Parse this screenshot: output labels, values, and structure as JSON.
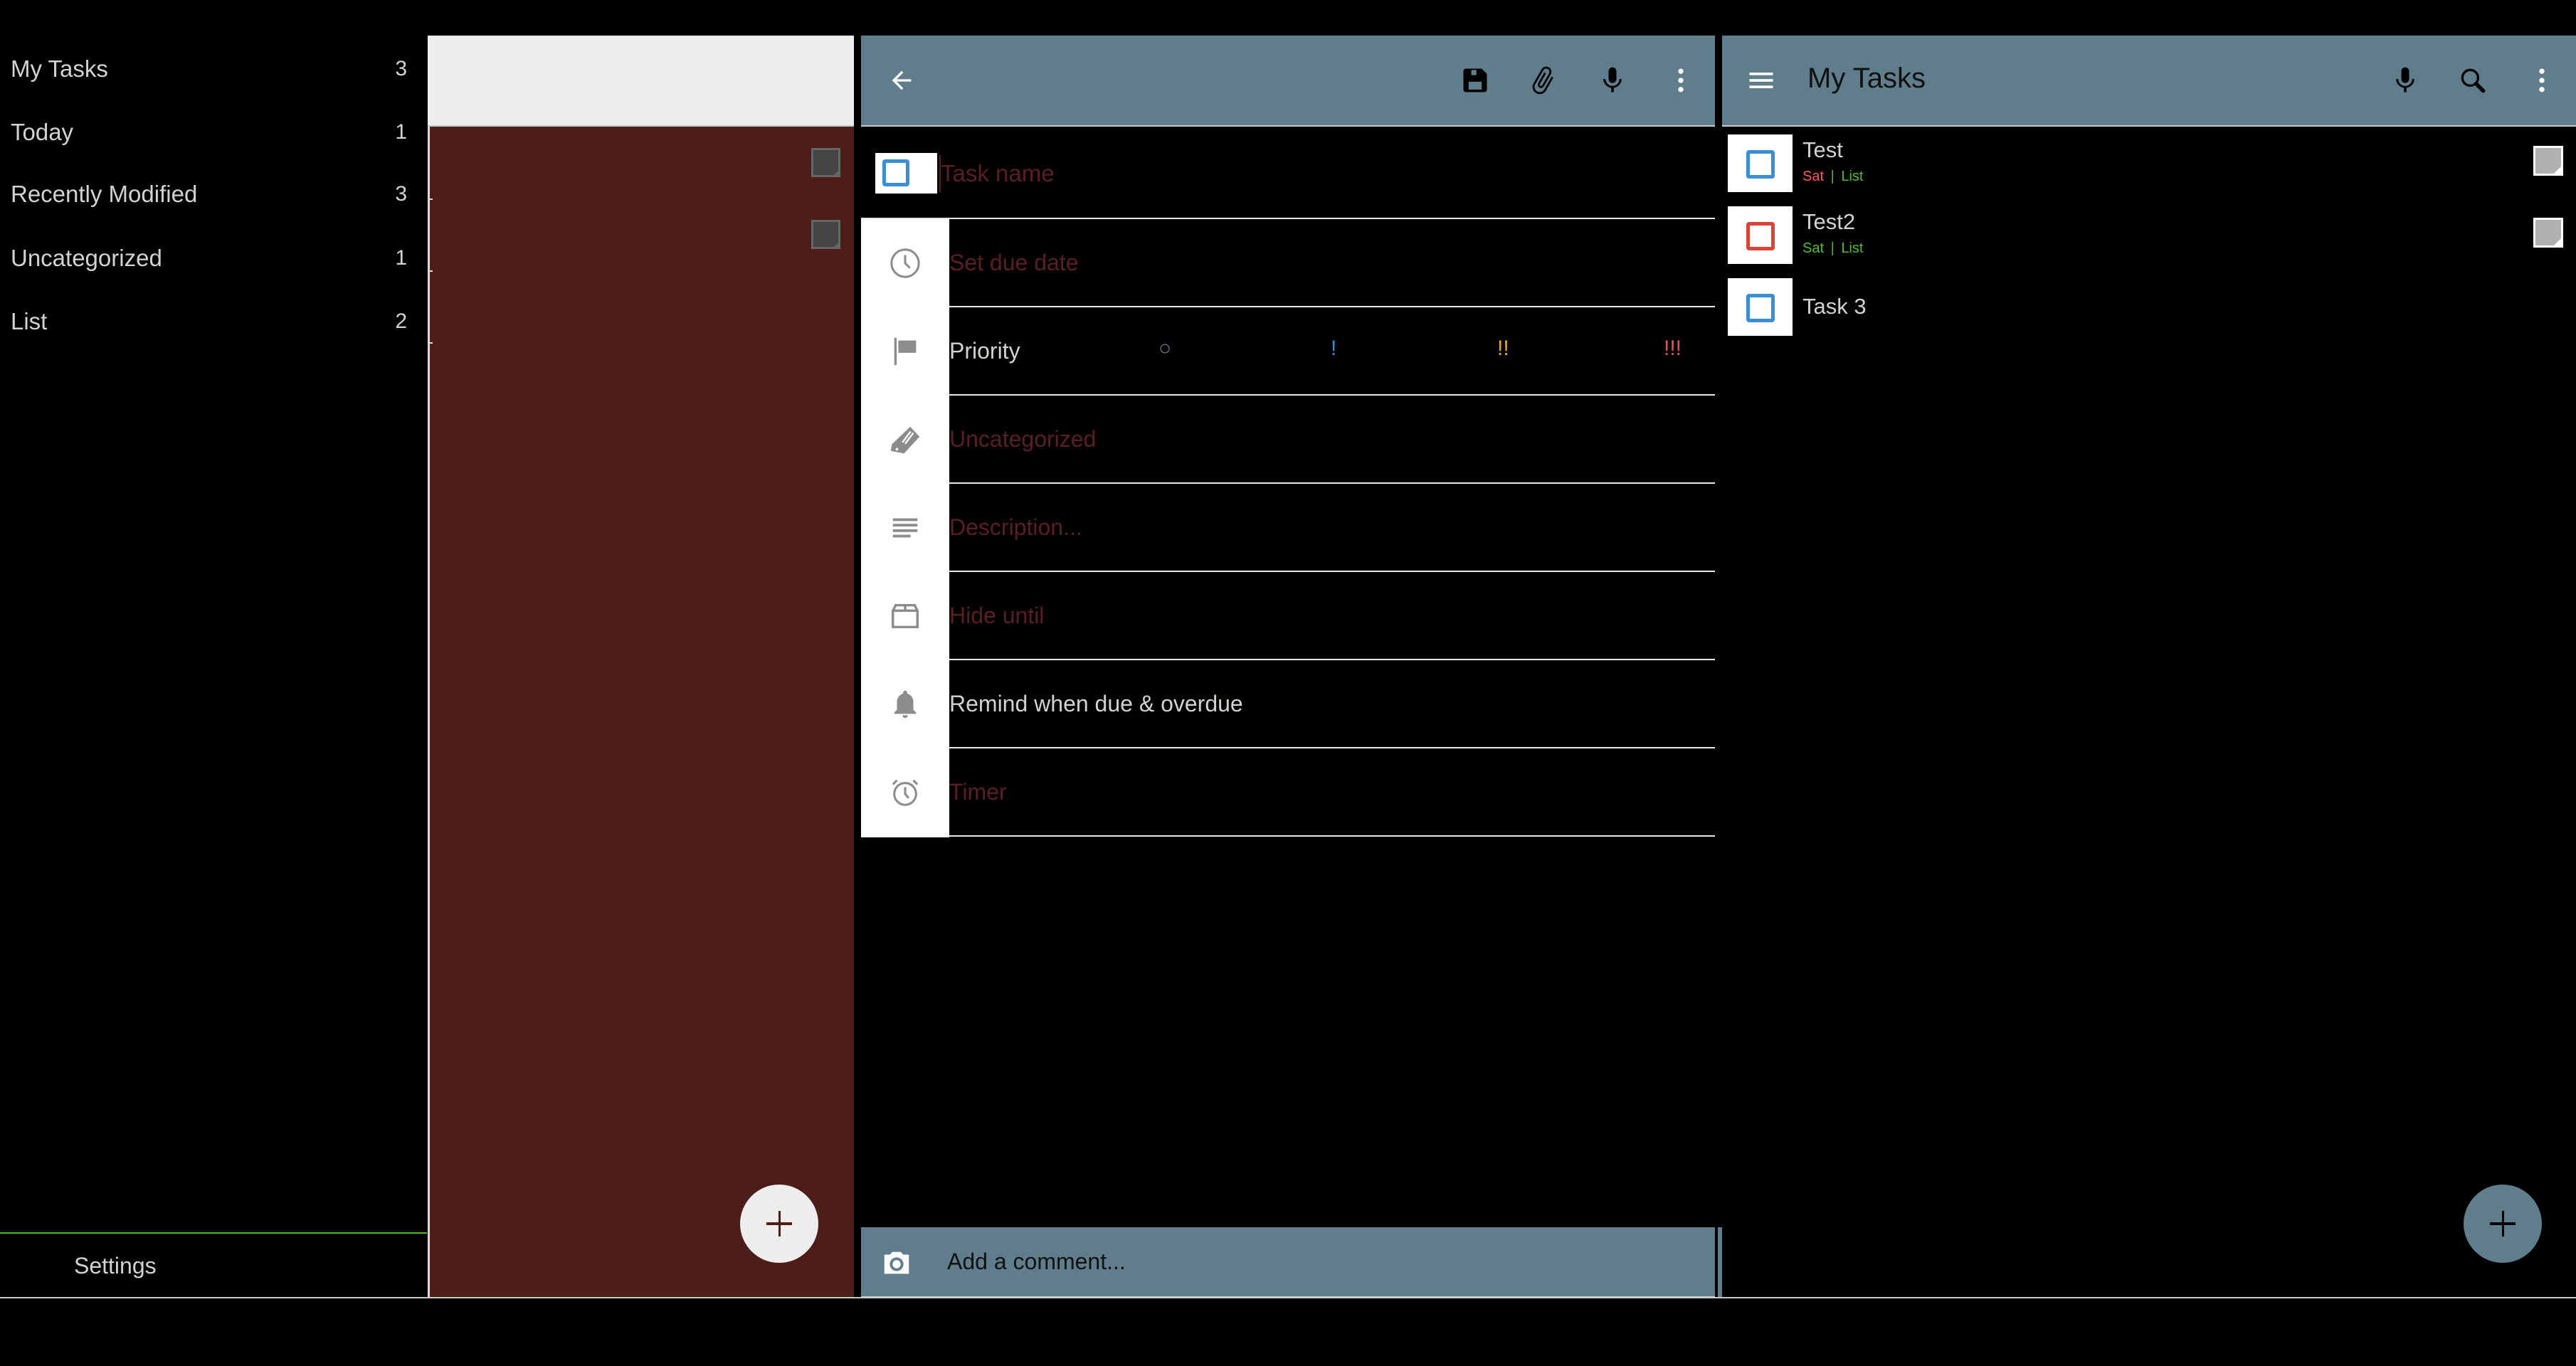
{
  "sidebar": {
    "items": [
      {
        "label": "My Tasks",
        "count": "3"
      },
      {
        "label": "Today",
        "count": "1"
      },
      {
        "label": "Recently Modified",
        "count": "3"
      },
      {
        "label": "Uncategorized",
        "count": "1"
      },
      {
        "label": "List",
        "count": "2"
      }
    ],
    "settings_label": "Settings",
    "separator_color": "#4fbf26"
  },
  "list_panel": {
    "background": "#4d1d1a",
    "fab_icon": "plus-icon"
  },
  "task_editor": {
    "toolbar": {
      "back_icon": "arrow-back-icon",
      "actions": [
        "save-icon",
        "attach-icon",
        "mic-icon",
        "more-vert-icon"
      ]
    },
    "task_name_placeholder": "Task name",
    "task_name_value": "",
    "rows": [
      {
        "icon": "clock-icon",
        "label": "Set due date",
        "is_set": false
      },
      {
        "icon": "flag-icon",
        "label": "Priority",
        "is_set": true
      },
      {
        "icon": "tag-icon",
        "label": "Uncategorized",
        "is_set": false
      },
      {
        "icon": "notes-icon",
        "label": "Description...",
        "is_set": false
      },
      {
        "icon": "box-icon",
        "label": "Hide until",
        "is_set": false
      },
      {
        "icon": "bell-icon",
        "label": "Remind when due & overdue",
        "is_set": true
      },
      {
        "icon": "alarm-icon",
        "label": "Timer",
        "is_set": false
      }
    ],
    "priority_options": [
      {
        "label": "○",
        "color": "#607d8b"
      },
      {
        "label": "!",
        "color": "#3a8fd4"
      },
      {
        "label": "!!",
        "color": "#f5a623"
      },
      {
        "label": "!!!",
        "color": "#e85555"
      }
    ],
    "comment_placeholder": "Add a comment...",
    "comment_icon": "camera-icon"
  },
  "main": {
    "title": "My Tasks",
    "actions": [
      "mic-icon",
      "search-icon",
      "more-vert-icon"
    ],
    "tasks": [
      {
        "title": "Test",
        "due": "Sat",
        "due_color": "#ff5a5a",
        "list": "List",
        "list_color": "#4fbf26",
        "checkbox_color": "#3a8fd4",
        "has_note": true
      },
      {
        "title": "Test2",
        "due": "Sat",
        "due_color": "#4fbf26",
        "list": "List",
        "list_color": "#4fbf26",
        "checkbox_color": "#d9433a",
        "has_note": true
      },
      {
        "title": "Task 3",
        "due": "",
        "list": "",
        "checkbox_color": "#3a8fd4",
        "has_note": false
      }
    ],
    "meta_separator": "|",
    "fab_icon": "plus-icon",
    "accent": "#607d8b"
  }
}
